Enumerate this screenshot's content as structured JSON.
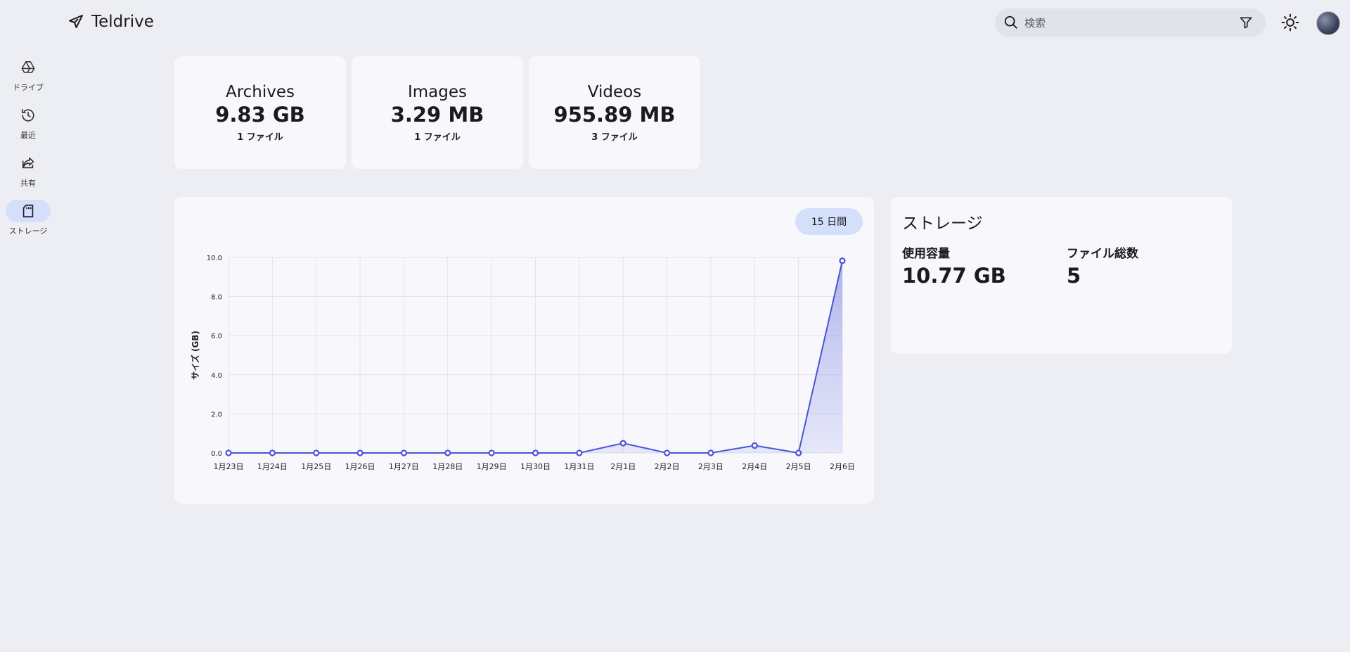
{
  "app": {
    "title": "Teldrive"
  },
  "search": {
    "placeholder": "検索"
  },
  "sidebar": {
    "items": [
      {
        "label": "ドライブ",
        "icon": "drive-icon",
        "active": false
      },
      {
        "label": "最近",
        "icon": "history-icon",
        "active": false
      },
      {
        "label": "共有",
        "icon": "share-icon",
        "active": false
      },
      {
        "label": "ストレージ",
        "icon": "sd-card-icon",
        "active": true
      }
    ]
  },
  "stats": [
    {
      "title": "Archives",
      "size": "9.83 GB",
      "count": "1 ファイル"
    },
    {
      "title": "Images",
      "size": "3.29 MB",
      "count": "1 ファイル"
    },
    {
      "title": "Videos",
      "size": "955.89 MB",
      "count": "3 ファイル"
    }
  ],
  "chart": {
    "range_label": "15 日間"
  },
  "storage": {
    "title": "ストレージ",
    "used_label": "使用容量",
    "used_value": "10.77 GB",
    "files_label": "ファイル総数",
    "files_value": "5"
  },
  "colors": {
    "accent": "#4856d6",
    "active_pill": "#d4e0fb",
    "background": "#eceef3",
    "card": "#f8f8fc"
  },
  "chart_data": {
    "type": "area",
    "ylabel": "サイズ (GB)",
    "xlabel": "",
    "title": "",
    "ylim": [
      0,
      10
    ],
    "yticks": [
      "0.0",
      "2.0",
      "4.0",
      "6.0",
      "8.0",
      "10.0"
    ],
    "categories": [
      "1月23日",
      "1月24日",
      "1月25日",
      "1月26日",
      "1月27日",
      "1月28日",
      "1月29日",
      "1月30日",
      "1月31日",
      "2月1日",
      "2月2日",
      "2月3日",
      "2月4日",
      "2月5日",
      "2月6日"
    ],
    "values": [
      0,
      0,
      0,
      0,
      0,
      0,
      0,
      0,
      0,
      0.5,
      0,
      0,
      0.38,
      0,
      9.83
    ],
    "grid": true,
    "legend": "none"
  }
}
